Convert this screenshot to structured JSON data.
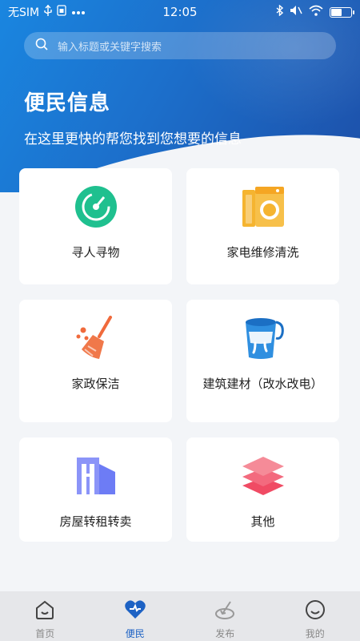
{
  "status": {
    "carrier": "无SIM",
    "time": "12:05"
  },
  "search": {
    "placeholder": "输入标题或关键字搜索"
  },
  "hero": {
    "title": "便民信息",
    "subtitle": "在这里更快的帮您找到您想要的信息"
  },
  "categories": [
    {
      "label": "寻人寻物",
      "icon": "radar-icon"
    },
    {
      "label": "家电维修清洗",
      "icon": "washing-machine-icon"
    },
    {
      "label": "家政保洁",
      "icon": "broom-icon"
    },
    {
      "label": "建筑建材（改水改电）",
      "icon": "paint-bucket-icon"
    },
    {
      "label": "房屋转租转卖",
      "icon": "building-icon"
    },
    {
      "label": "其他",
      "icon": "layers-icon"
    }
  ],
  "tabs": [
    {
      "label": "首页",
      "icon": "home-icon",
      "active": false
    },
    {
      "label": "便民",
      "icon": "heart-icon",
      "active": true
    },
    {
      "label": "发布",
      "icon": "publish-icon",
      "active": false
    },
    {
      "label": "我的",
      "icon": "smile-icon",
      "active": false
    }
  ],
  "colors": {
    "primary": "#1d62c4",
    "radar": "#1fc08f",
    "washer": "#f5b430",
    "broom": "#f06a3c",
    "bucket": "#2f8fe0",
    "building": "#6d7cf5",
    "layers": "#f04b64"
  }
}
